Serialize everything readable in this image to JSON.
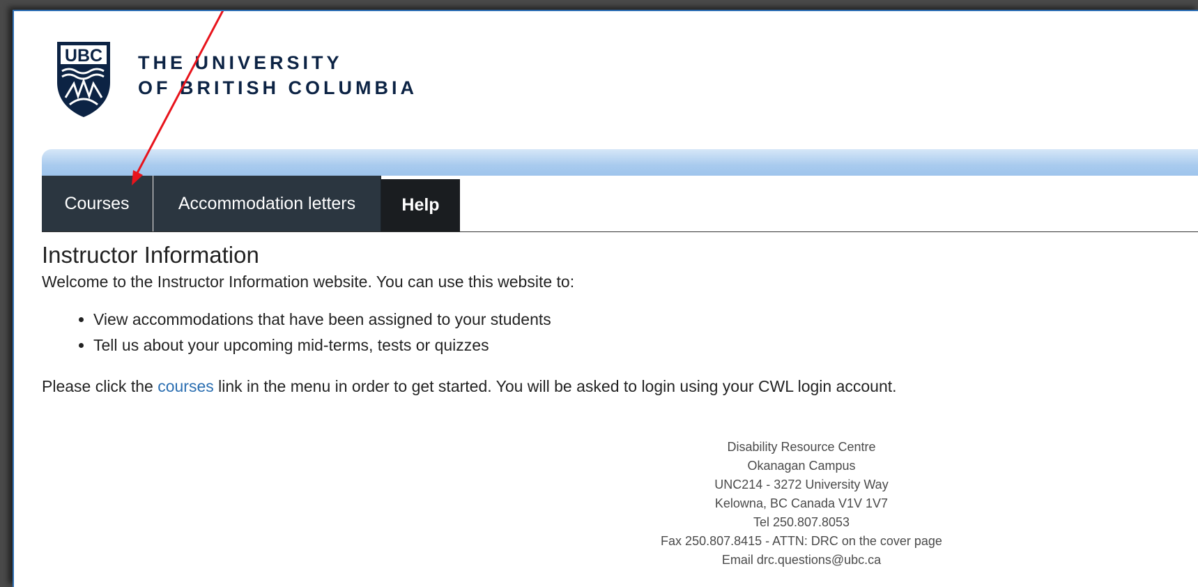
{
  "header": {
    "logo_text": "UBC",
    "wordmark_line1": "THE UNIVERSITY",
    "wordmark_line2": "OF BRITISH COLUMBIA"
  },
  "nav": {
    "tabs": [
      {
        "label": "Courses"
      },
      {
        "label": "Accommodation letters"
      },
      {
        "label": "Help"
      }
    ]
  },
  "main": {
    "title": "Instructor Information",
    "intro": "Welcome to the Instructor Information website. You can use this website to:",
    "features": [
      "View accommodations that have been assigned to your students",
      "Tell us about your upcoming mid-terms, tests or quizzes"
    ],
    "cta_prefix": "Please click the ",
    "cta_link": "courses",
    "cta_suffix": " link in the menu in order to get started. You will be asked to login using your CWL login account."
  },
  "footer": {
    "lines": [
      "Disability Resource Centre",
      "Okanagan Campus",
      "UNC214 - 3272 University Way",
      "Kelowna, BC Canada V1V 1V7",
      "Tel 250.807.8053",
      "Fax 250.807.8415 - ATTN: DRC on the cover page",
      "Email drc.questions@ubc.ca"
    ]
  },
  "colors": {
    "brand_navy": "#0c2344",
    "nav_bg": "#2b3640",
    "nav_active_bg": "#1a1d20",
    "link": "#2a6eb1",
    "annotation_arrow": "#e8141c"
  },
  "annotation": {
    "icon": "red-arrow-icon",
    "target": "Courses"
  }
}
